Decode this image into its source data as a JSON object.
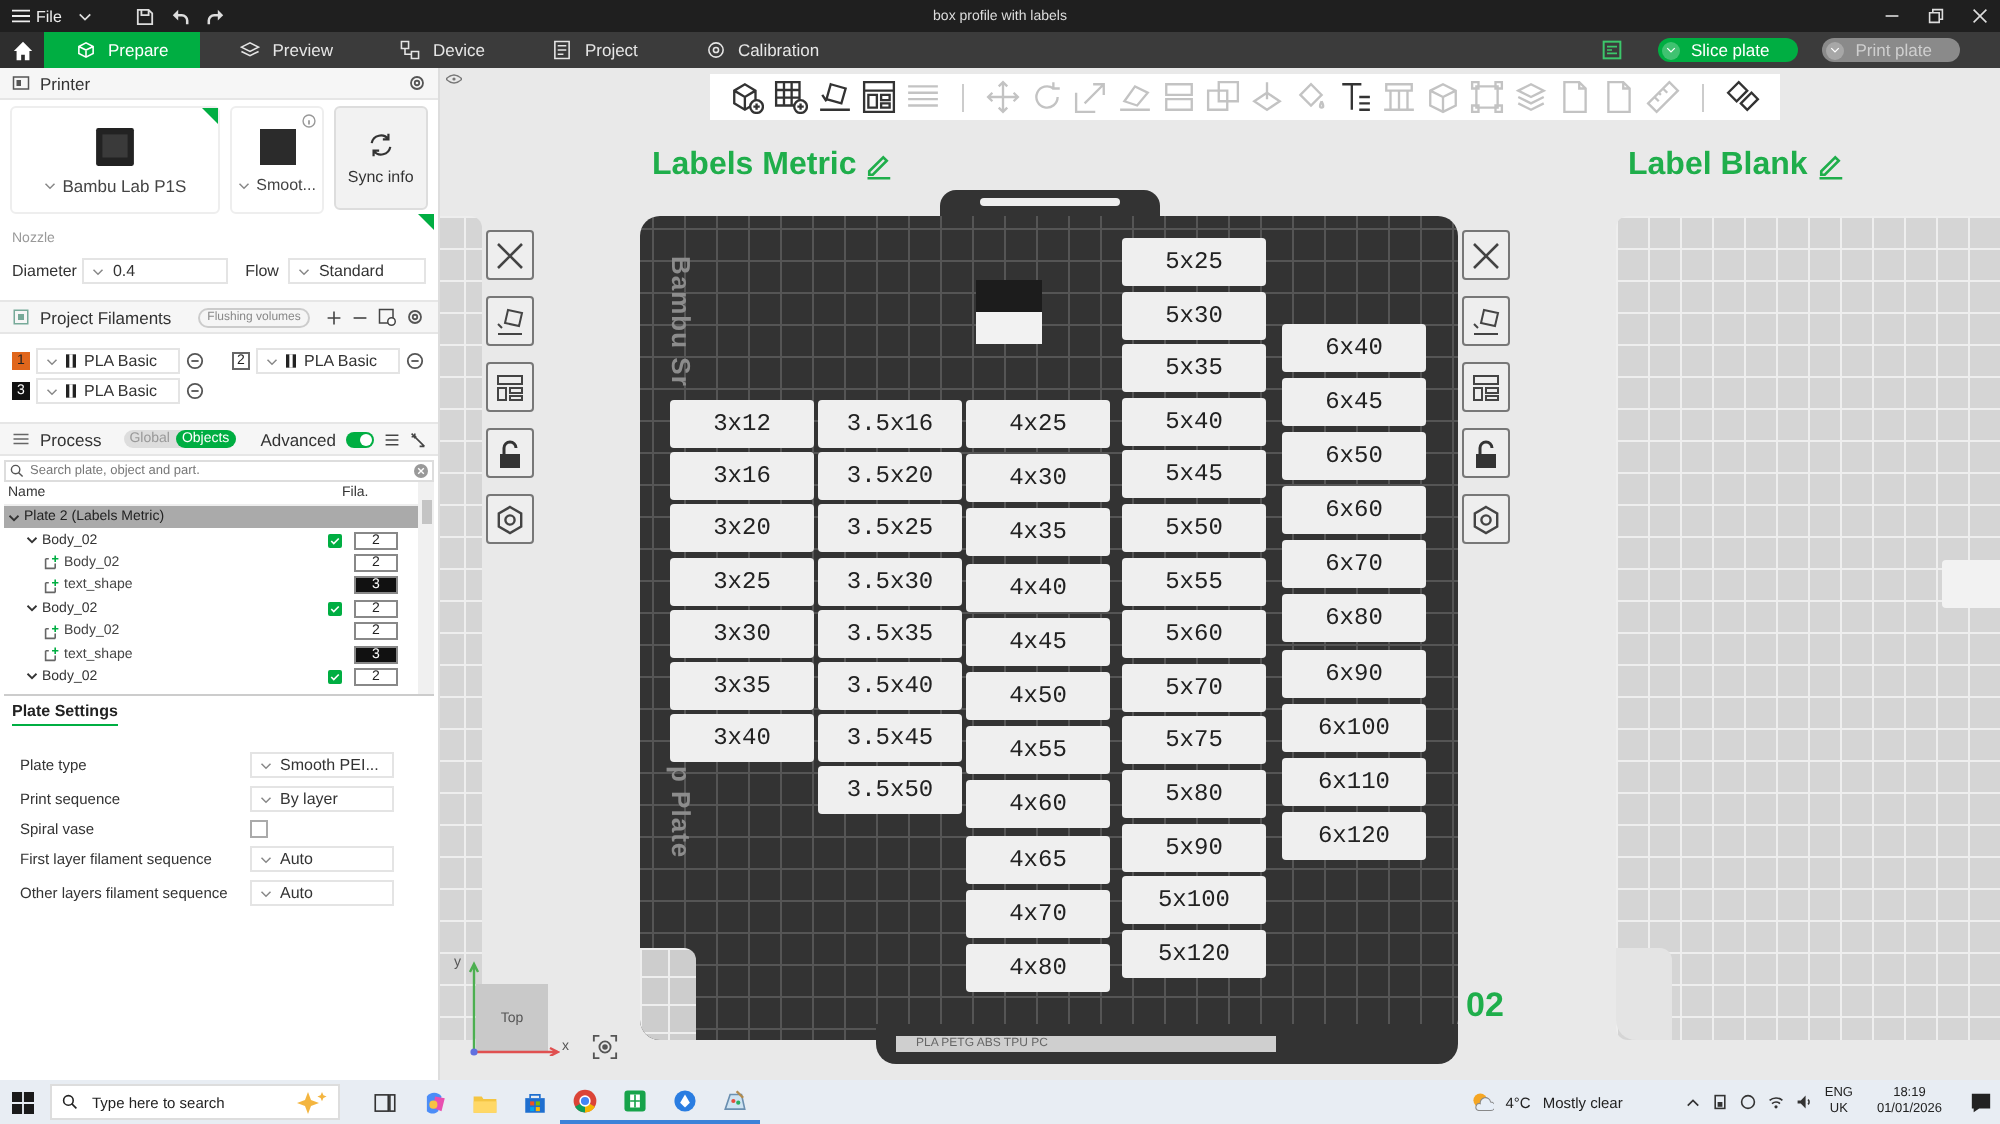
{
  "window": {
    "menu": "File",
    "title": "box profile with labels"
  },
  "tabs": [
    {
      "label": "Prepare",
      "selected": true
    },
    {
      "label": "Preview",
      "selected": false
    },
    {
      "label": "Device",
      "selected": false
    },
    {
      "label": "Project",
      "selected": false
    },
    {
      "label": "Calibration",
      "selected": false
    }
  ],
  "actions": [
    {
      "label": "Slice plate",
      "disabled": false
    },
    {
      "label": "Print plate",
      "disabled": true
    }
  ],
  "toolbar": [
    [
      {
        "kind": "cube-plus",
        "disabled": false
      },
      {
        "kind": "grid-plus",
        "disabled": false
      },
      {
        "kind": "orient",
        "disabled": false
      },
      {
        "kind": "arrange",
        "disabled": false
      },
      {
        "kind": "stripes",
        "disabled": true
      }
    ],
    [
      {
        "kind": "move",
        "disabled": true
      },
      {
        "kind": "rotate",
        "disabled": true
      },
      {
        "kind": "scale",
        "disabled": true
      },
      {
        "kind": "face",
        "disabled": true
      },
      {
        "kind": "split",
        "disabled": true
      },
      {
        "kind": "boolean",
        "disabled": true
      },
      {
        "kind": "cut",
        "disabled": true
      },
      {
        "kind": "paint",
        "disabled": true
      },
      {
        "kind": "text",
        "disabled": false
      },
      {
        "kind": "support",
        "disabled": true
      },
      {
        "kind": "cube",
        "disabled": true
      },
      {
        "kind": "frame",
        "disabled": true
      },
      {
        "kind": "stack",
        "disabled": true
      },
      {
        "kind": "page",
        "disabled": true
      },
      {
        "kind": "page",
        "disabled": true
      },
      {
        "kind": "ruler",
        "disabled": true
      }
    ],
    [
      {
        "kind": "assembly",
        "disabled": false
      }
    ]
  ],
  "printer": {
    "title": "Printer",
    "model": "Bambu Lab P1S",
    "plate": "Smoot...",
    "sync": "Sync info",
    "nozzle_label": "Nozzle",
    "diameter_label": "Diameter",
    "diameter": "0.4",
    "flow_label": "Flow",
    "flow": "Standard"
  },
  "filaments": {
    "title": "Project Filaments",
    "flushing": "Flushing volumes",
    "items": [
      {
        "index": "1",
        "name": "PLA Basic",
        "color": "#e0661c"
      },
      {
        "index": "2",
        "name": "PLA Basic",
        "color": "#ffffff"
      },
      {
        "index": "3",
        "name": "PLA Basic",
        "color": "#111111"
      }
    ]
  },
  "process": {
    "title": "Process",
    "modes": [
      {
        "label": "Global",
        "selected": false
      },
      {
        "label": "Objects",
        "selected": true
      }
    ],
    "advanced_label": "Advanced",
    "advanced": true,
    "search_placeholder": "Search plate, object and part."
  },
  "objects": {
    "columns": [
      "Name",
      "Fila."
    ],
    "rows": [
      {
        "name": "Plate 2 (Labels Metric)",
        "kind": "plate",
        "selected": true,
        "expanded": true,
        "children": [
          {
            "name": "Body_02",
            "kind": "object",
            "selected": false,
            "expanded": true,
            "checked": true,
            "filament": "2",
            "children": [
              {
                "name": "Body_02",
                "kind": "part",
                "selected": false,
                "filament": "2"
              },
              {
                "name": "text_shape",
                "kind": "part",
                "selected": false,
                "filament": "3"
              }
            ]
          },
          {
            "name": "Body_02",
            "kind": "object",
            "selected": false,
            "expanded": true,
            "checked": true,
            "filament": "2",
            "children": [
              {
                "name": "Body_02",
                "kind": "part",
                "selected": false,
                "filament": "2"
              },
              {
                "name": "text_shape",
                "kind": "part",
                "selected": false,
                "filament": "3"
              }
            ]
          },
          {
            "name": "Body_02",
            "kind": "object",
            "selected": false,
            "expanded": true,
            "checked": true,
            "filament": "2"
          }
        ]
      }
    ]
  },
  "plate_settings": {
    "tab": "Plate Settings",
    "rows": [
      {
        "label": "Plate type",
        "kind": "select",
        "value": "Smooth PEI..."
      },
      {
        "label": "Print sequence",
        "kind": "select",
        "value": "By layer"
      },
      {
        "label": "Spiral vase",
        "kind": "checkbox",
        "checked": false
      },
      {
        "label": "First layer filament sequence",
        "kind": "select",
        "value": "Auto"
      },
      {
        "label": "Other layers filament sequence",
        "kind": "select",
        "value": "Auto"
      }
    ]
  },
  "plates": [
    {
      "kind": "light",
      "locked": false
    },
    {
      "name": "Labels Metric",
      "kind": "dark",
      "locked": false,
      "number": "02",
      "bed_text": [
        "Bambu Sr",
        "p Plate"
      ],
      "strip_text": "PLA PETG ABS TPU PC",
      "columns": [
        [
          "3x12",
          "3x16",
          "3x20",
          "3x25",
          "3x30",
          "3x35",
          "3x40"
        ],
        [
          "3.5x16",
          "3.5x20",
          "3.5x25",
          "3.5x30",
          "3.5x35",
          "3.5x40",
          "3.5x45",
          "3.5x50"
        ],
        [
          "4x25",
          "4x30",
          "4x35",
          "4x40",
          "4x45",
          "4x50",
          "4x55",
          "4x60",
          "4x65",
          "4x70",
          "4x80"
        ],
        [
          "5x25",
          "5x30",
          "5x35",
          "5x40",
          "5x45",
          "5x50",
          "5x55",
          "5x60",
          "5x70",
          "5x75",
          "5x80",
          "5x90",
          "5x100",
          "5x120"
        ],
        [
          "6x40",
          "6x45",
          "6x50",
          "6x60",
          "6x70",
          "6x80",
          "6x90",
          "6x100",
          "6x110",
          "6x120"
        ]
      ]
    },
    {
      "name": "Label Blank",
      "kind": "light",
      "objects": [
        {
          "kind": "blank"
        }
      ]
    }
  ],
  "view_cube": {
    "face": "Top",
    "x_label": "x",
    "y_label": "y"
  },
  "taskbar": {
    "search_placeholder": "Type here to search",
    "apps": [
      {
        "kind": "task-view",
        "running": false
      },
      {
        "kind": "copilot",
        "running": false
      },
      {
        "kind": "folder",
        "running": false
      },
      {
        "kind": "store",
        "running": false
      },
      {
        "kind": "browser",
        "running": true
      },
      {
        "kind": "sheet",
        "running": true
      },
      {
        "kind": "globe",
        "running": true
      },
      {
        "kind": "paint",
        "running": true
      }
    ],
    "temperature": "4°C",
    "weather": "Mostly clear",
    "language": "ENG",
    "region": "UK",
    "time": "18:19",
    "date": "01/01/2026"
  }
}
